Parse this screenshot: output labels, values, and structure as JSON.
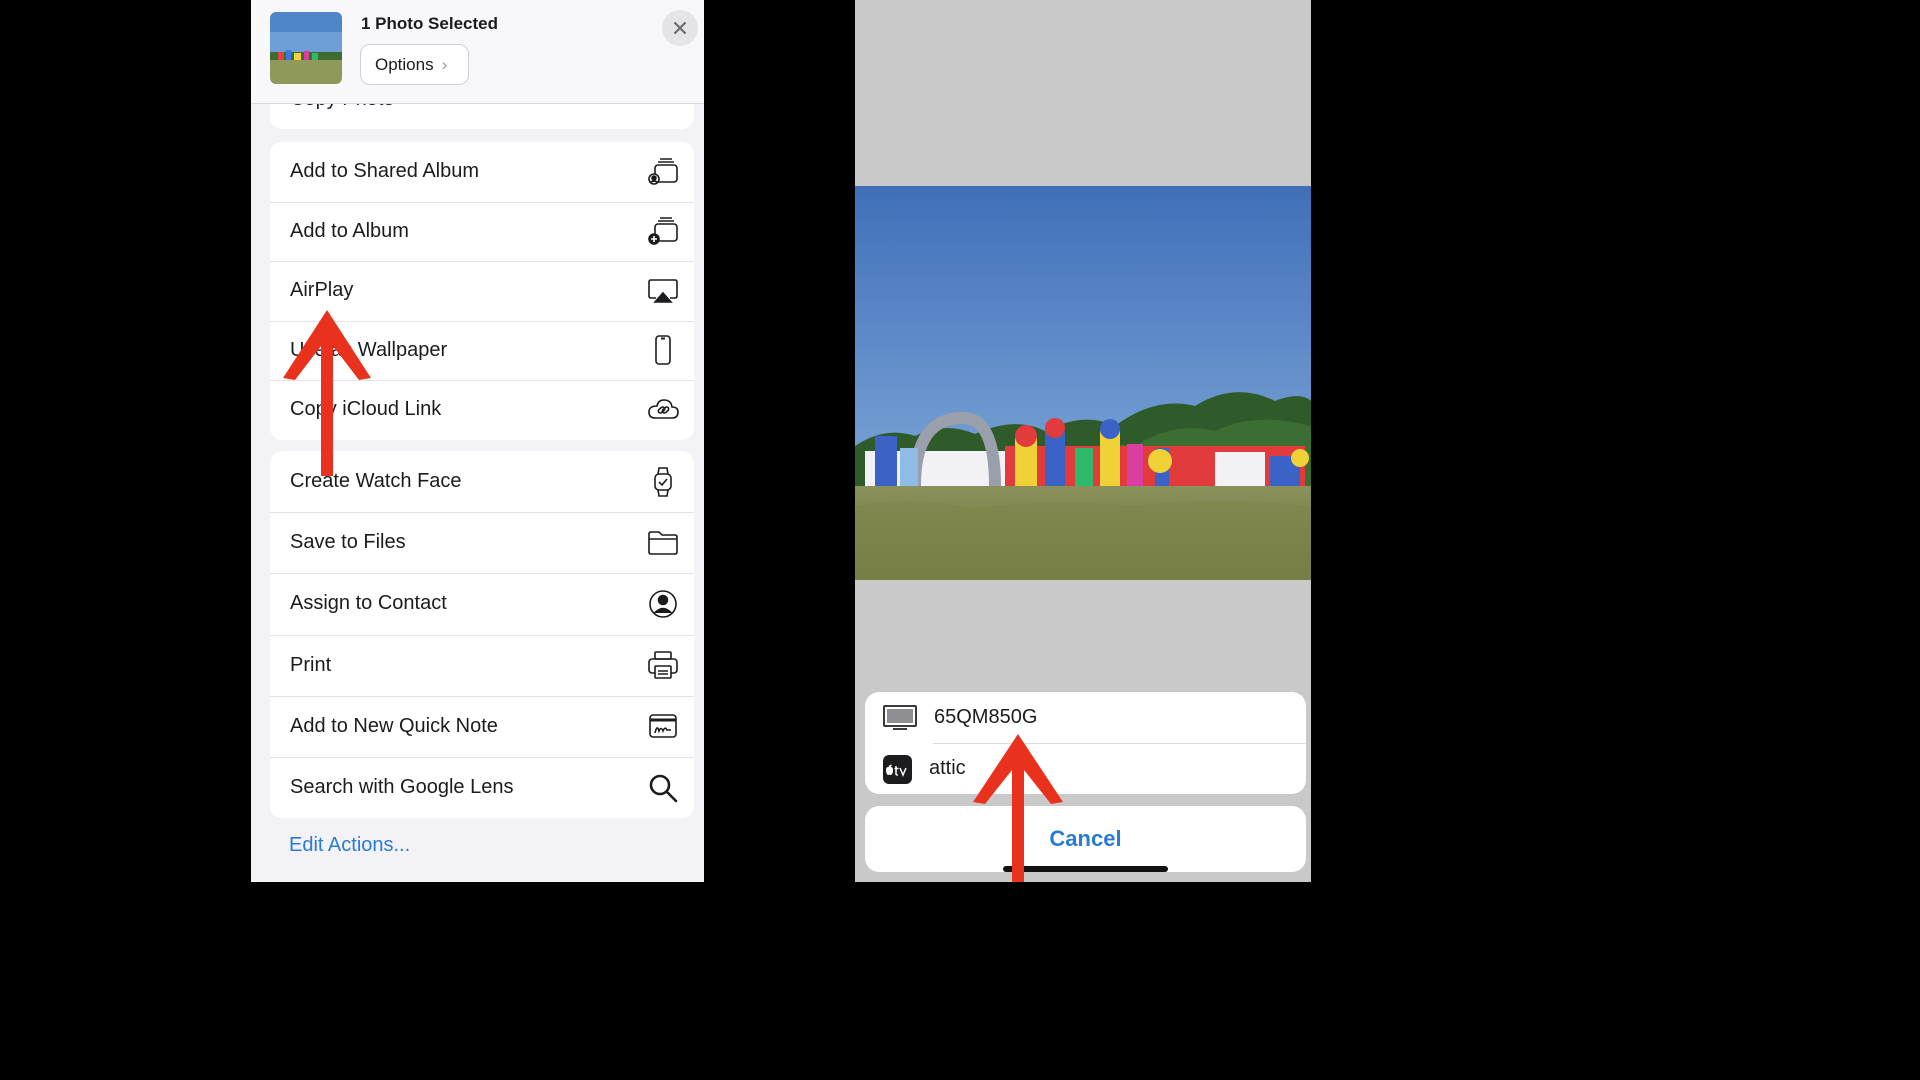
{
  "share_sheet": {
    "selection_title": "1 Photo Selected",
    "options_label": "Options",
    "options_chevron": "›",
    "partial_item_label": "Copy Photo",
    "group1": [
      {
        "label": "Add to Shared Album",
        "icon": "shared-album-icon"
      },
      {
        "label": "Add to Album",
        "icon": "add-album-icon"
      },
      {
        "label": "AirPlay",
        "icon": "airplay-icon"
      },
      {
        "label": "Use as Wallpaper",
        "icon": "phone-icon"
      },
      {
        "label": "Copy iCloud Link",
        "icon": "icloud-link-icon"
      }
    ],
    "group2": [
      {
        "label": "Create Watch Face",
        "icon": "watch-icon"
      },
      {
        "label": "Save to Files",
        "icon": "folder-icon"
      },
      {
        "label": "Assign to Contact",
        "icon": "contact-icon"
      },
      {
        "label": "Print",
        "icon": "printer-icon"
      },
      {
        "label": "Add to New Quick Note",
        "icon": "quick-note-icon"
      },
      {
        "label": "Search with Google Lens",
        "icon": "search-icon"
      }
    ],
    "edit_actions_label": "Edit Actions..."
  },
  "airplay": {
    "devices": [
      {
        "label": "65QM850G",
        "icon": "tv-icon"
      },
      {
        "label": "attic",
        "icon": "apple-tv-icon"
      }
    ],
    "cancel_label": "Cancel"
  },
  "colors": {
    "accent": "#2a7bd5",
    "arrow": "#e8321e",
    "sheet_background": "#f2f2f7"
  }
}
